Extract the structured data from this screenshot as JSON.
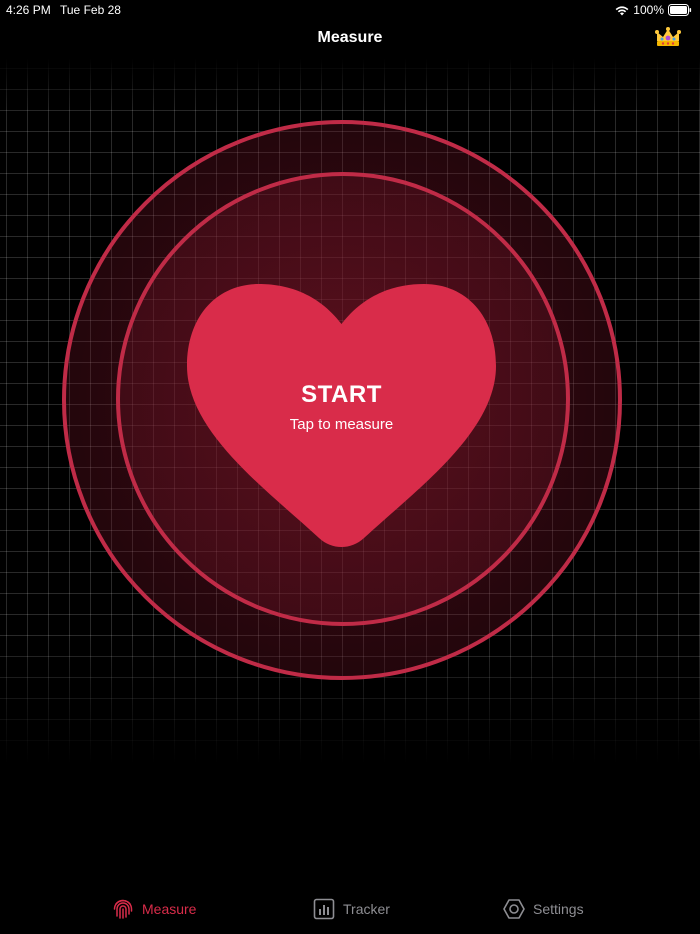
{
  "status_bar": {
    "time": "4:26 PM",
    "date": "Tue Feb 28",
    "battery": "100%"
  },
  "nav": {
    "title": "Measure",
    "premium_icon": "crown-icon"
  },
  "measure": {
    "start_label": "START",
    "hint": "Tap to measure"
  },
  "tabs": [
    {
      "label": "Measure",
      "icon": "fingerprint-icon",
      "selected": true
    },
    {
      "label": "Tracker",
      "icon": "chart-icon",
      "selected": false
    },
    {
      "label": "Settings",
      "icon": "hexagon-gear-icon",
      "selected": false
    }
  ],
  "colors": {
    "accent": "#d92c4a",
    "ring": "#c02b47",
    "heart": "#d92c4a",
    "tab_inactive": "#8e8e93",
    "background": "#000000"
  }
}
